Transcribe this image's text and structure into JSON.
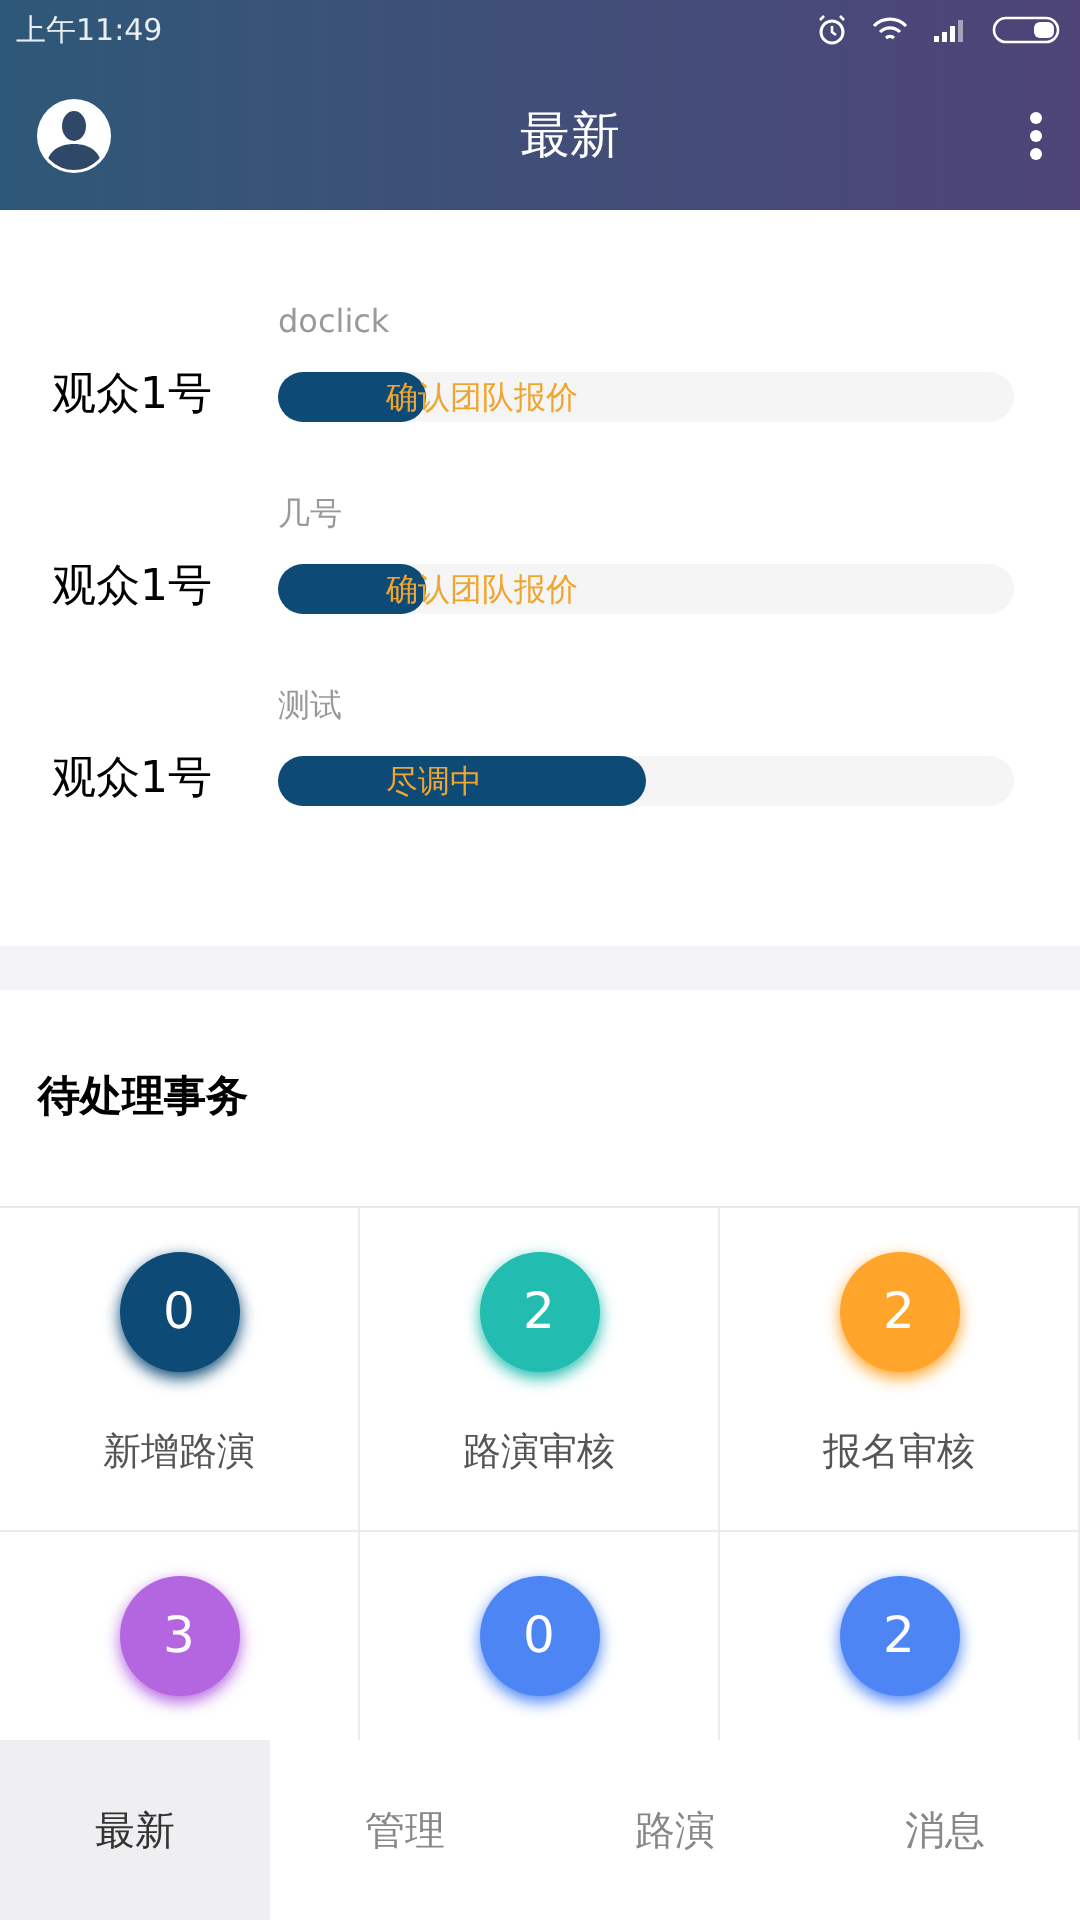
{
  "status_bar": {
    "time": "上午11:49"
  },
  "header": {
    "title": "最新"
  },
  "progress_items": [
    {
      "name": "观众1号",
      "project": "doclick",
      "status": "确认团队报价",
      "level": 0.2
    },
    {
      "name": "观众1号",
      "project": "几号",
      "status": "确认团队报价",
      "level": 0.2
    },
    {
      "name": "观众1号",
      "project": "测试",
      "status": "尽调中",
      "level": 0.5
    }
  ],
  "pending": {
    "title": "待处理事务",
    "items": [
      {
        "count": "0",
        "label": "新增路演",
        "color": "#0d4a75"
      },
      {
        "count": "2",
        "label": "路演审核",
        "color": "#22bdb0"
      },
      {
        "count": "2",
        "label": "报名审核",
        "color": "#ffa52b"
      },
      {
        "count": "3",
        "color": "#b366e0"
      },
      {
        "count": "0",
        "color": "#4d85f5"
      },
      {
        "count": "2",
        "color": "#4d85f5"
      }
    ]
  },
  "tab_bar": [
    {
      "label": "最新",
      "selected": true
    },
    {
      "label": "管理",
      "selected": false
    },
    {
      "label": "路演",
      "selected": false
    },
    {
      "label": "消息",
      "selected": false
    }
  ]
}
